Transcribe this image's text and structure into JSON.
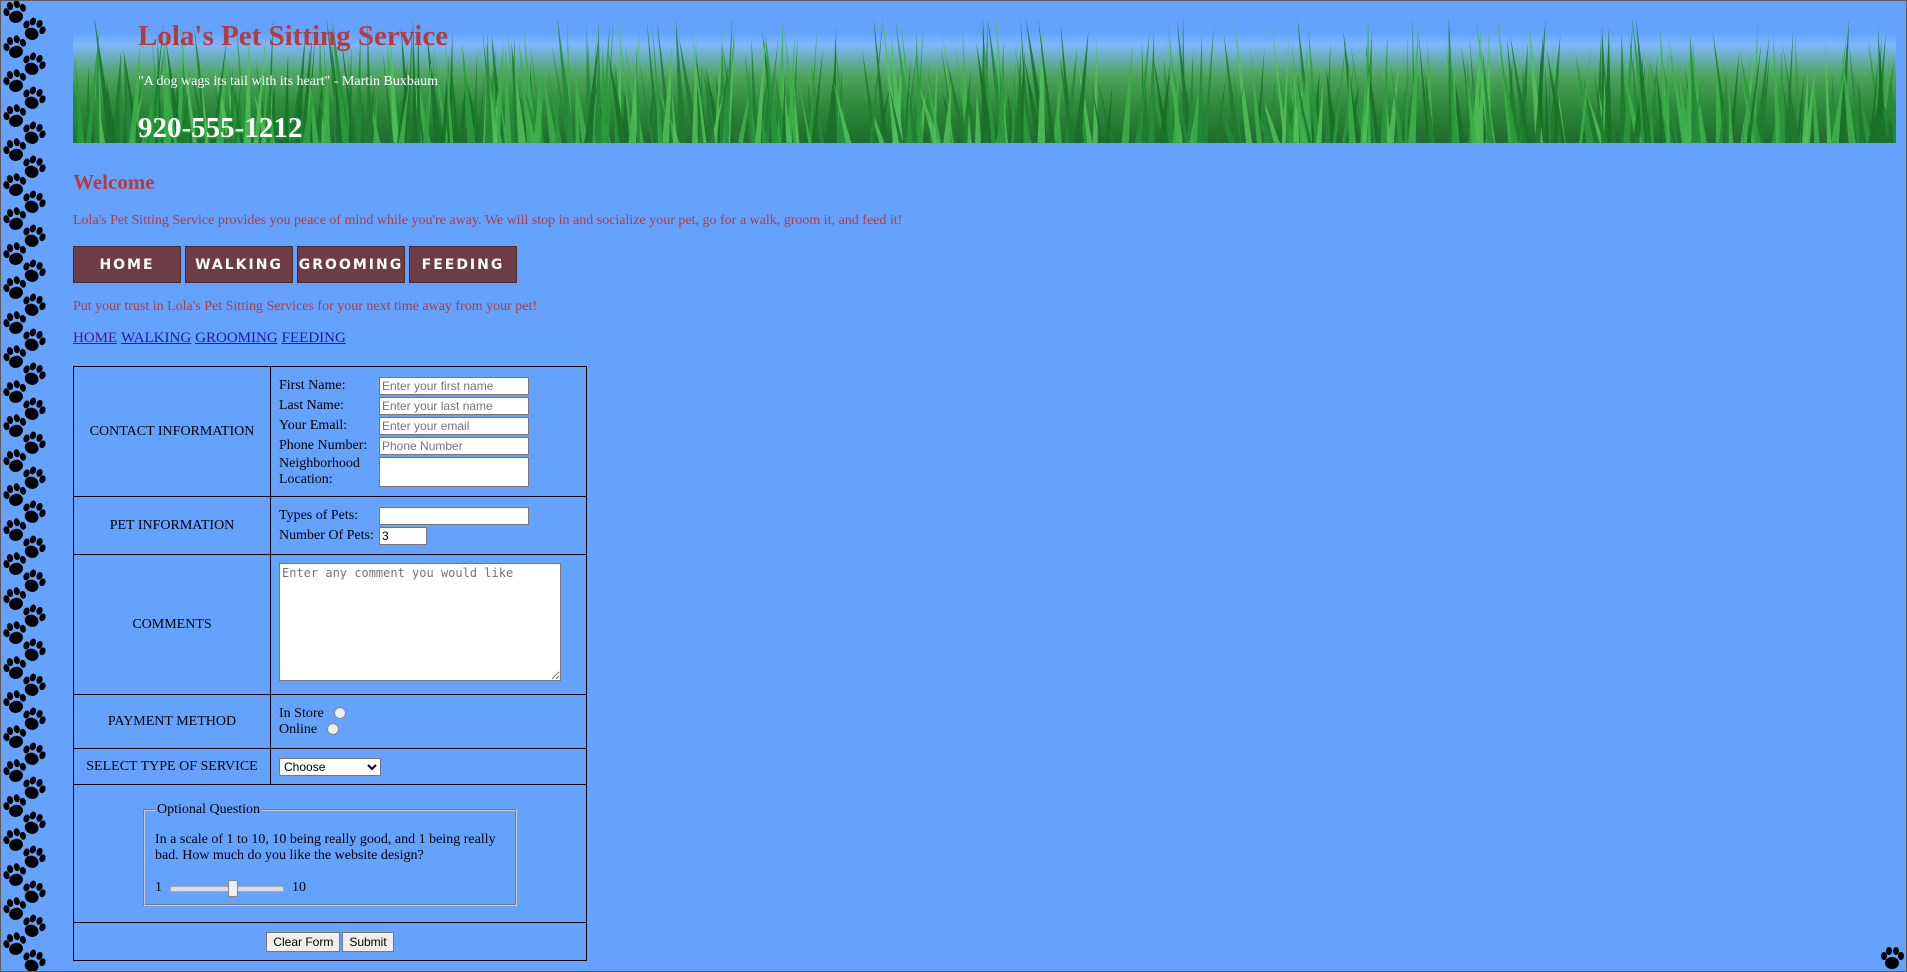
{
  "header": {
    "title": "Lola's Pet Sitting Service",
    "quote": "\"A dog wags its tail with its heart\" - Martin Buxbaum",
    "phone": "920-555-1212"
  },
  "welcome": {
    "heading": "Welcome",
    "intro": "Lola's Pet Sitting Service provides you peace of mind while you're away. We will stop in and socialize your pet, go for a walk, groom it, and feed it!"
  },
  "nav_buttons": [
    "HOME",
    "WALKING",
    "GROOMING",
    "FEEDING"
  ],
  "trust_text": "Put your trust in Lola's Pet Sitting Services for your next time away from your pet!",
  "text_nav": [
    "HOME",
    "WALKING",
    "GROOMING",
    "FEEDING"
  ],
  "form": {
    "contact": {
      "label": "CONTACT INFORMATION",
      "first_name_label": "First Name:",
      "first_name_placeholder": "Enter your first name",
      "last_name_label": "Last Name:",
      "last_name_placeholder": "Enter your last name",
      "email_label": "Your Email:",
      "email_placeholder": "Enter your email",
      "phone_label": "Phone Number:",
      "phone_placeholder": "Phone Number",
      "neighborhood_label": "Neighborhood Location:"
    },
    "pet": {
      "label": "PET INFORMATION",
      "types_label": "Types of Pets:",
      "number_label": "Number Of Pets:",
      "number_value": "3"
    },
    "comments": {
      "label": "COMMENTS",
      "placeholder": "Enter any comment you would like"
    },
    "payment": {
      "label": "PAYMENT METHOD",
      "option_store": "In Store",
      "option_online": "Online"
    },
    "service": {
      "label": "SELECT TYPE OF SERVICE",
      "selected": "Choose"
    },
    "optional": {
      "legend": "Optional Question",
      "question": "In a scale of 1 to 10, 10 being really good, and 1 being really bad. How much do you like the website design?",
      "min_label": "1",
      "max_label": "10",
      "slider_fraction": 0.55
    },
    "buttons": {
      "clear": "Clear Form",
      "submit": "Submit"
    }
  },
  "colors": {
    "background": "#64a2fd",
    "title_red": "#b43b3e",
    "nav_button": "#6e3c45"
  }
}
